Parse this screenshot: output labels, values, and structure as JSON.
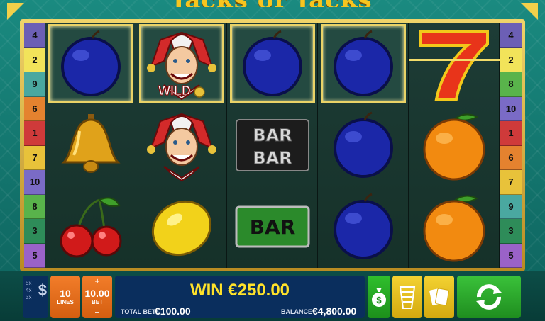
{
  "game": {
    "title": "Jacks or Jacks"
  },
  "paylines": {
    "left": [
      {
        "label": "4",
        "color": "#6c5fb5"
      },
      {
        "label": "2",
        "color": "#f2e35a"
      },
      {
        "label": "9",
        "color": "#4aa8a0"
      },
      {
        "label": "6",
        "color": "#e4822f"
      },
      {
        "label": "1",
        "color": "#cf3a3a"
      },
      {
        "label": "7",
        "color": "#e8c23a"
      },
      {
        "label": "10",
        "color": "#7a6bc6"
      },
      {
        "label": "8",
        "color": "#59b34b"
      },
      {
        "label": "3",
        "color": "#2e8c59"
      },
      {
        "label": "5",
        "color": "#9a62c8"
      }
    ],
    "right": [
      {
        "label": "4",
        "color": "#6c5fb5"
      },
      {
        "label": "2",
        "color": "#f2e35a"
      },
      {
        "label": "8",
        "color": "#59b34b"
      },
      {
        "label": "10",
        "color": "#7a6bc6"
      },
      {
        "label": "1",
        "color": "#cf3a3a"
      },
      {
        "label": "6",
        "color": "#e4822f"
      },
      {
        "label": "7",
        "color": "#e8c23a"
      },
      {
        "label": "9",
        "color": "#4aa8a0"
      },
      {
        "label": "3",
        "color": "#2e8c59"
      },
      {
        "label": "5",
        "color": "#9a62c8"
      }
    ]
  },
  "reels": [
    [
      "plum",
      "bell",
      "cherries"
    ],
    [
      "wild-jester",
      "jester",
      "lemon"
    ],
    [
      "plum",
      "double-bar",
      "bar"
    ],
    [
      "plum",
      "plum",
      "plum"
    ],
    [
      "seven",
      "orange",
      "orange"
    ]
  ],
  "symbol_labels": {
    "wild": "WILD",
    "bar": "BAR"
  },
  "winning_cells": [
    [
      0,
      0
    ],
    [
      1,
      0
    ],
    [
      2,
      0
    ],
    [
      3,
      0
    ]
  ],
  "controls": {
    "speed_options": [
      "5x",
      "4x",
      "3x"
    ],
    "speed_icon": "dollar-icon",
    "lines_value": "10",
    "lines_label": "LINES",
    "bet_value": "10.00",
    "bet_label": "BET",
    "bet_plus": "+",
    "bet_minus": "−",
    "win_text": "WIN €250.00",
    "total_bet_label": "TOTAL BET",
    "total_bet_value": "€100.00",
    "balance_label": "BALANCE",
    "balance_value": "€4,800.00",
    "risk_icon": "money-bag-icon",
    "ladder_icon": "ladder-icon",
    "cards_icon": "cards-icon",
    "spin_icon": "autoplay-arrows-icon"
  },
  "colors": {
    "accent_gold": "#f2d04a",
    "win_yellow": "#ffe22a",
    "panel_blue": "#0a2e5d",
    "spin_green": "#2aa82a"
  }
}
